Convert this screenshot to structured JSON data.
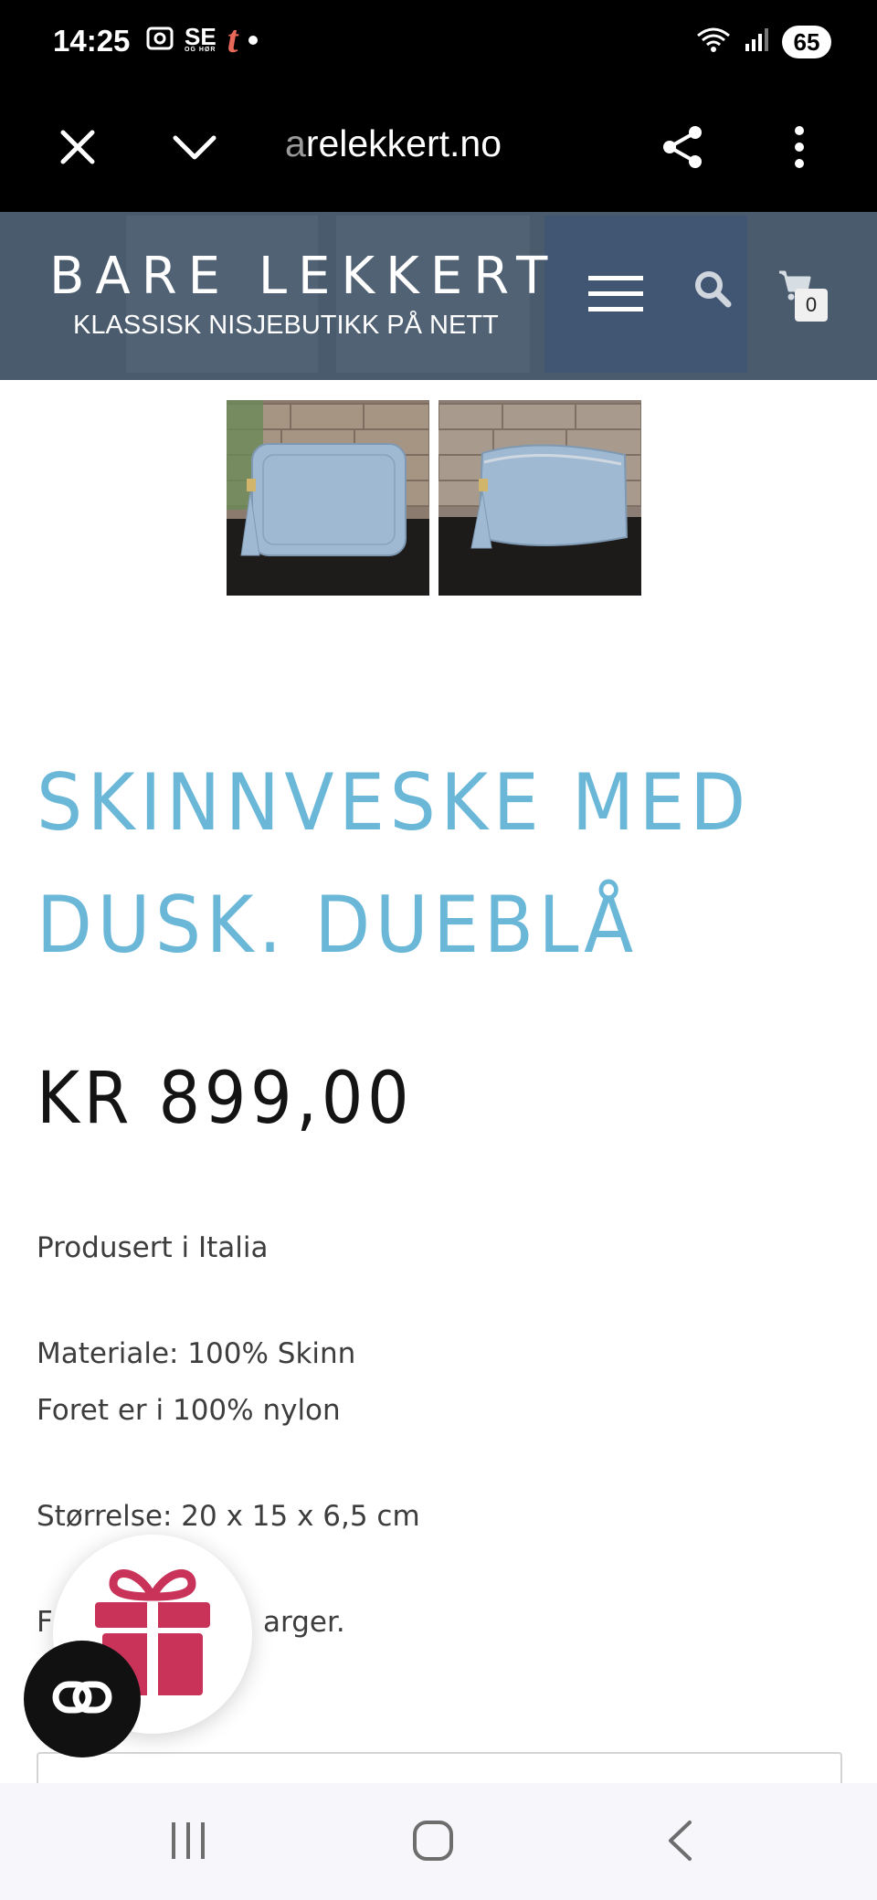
{
  "status_bar": {
    "time": "14:25",
    "app_icons": [
      "screenshot-icon",
      "se-og-hor-icon",
      "tv2-t-icon",
      "notification-dot-icon"
    ],
    "se_label": "SE",
    "se_sub": "OG HØR",
    "t_label": "t",
    "battery": "65"
  },
  "browser": {
    "url_faded": "a",
    "url": "relekkert.no"
  },
  "site": {
    "title": "BARE LEKKERT",
    "tagline": "KLASSISK NISJEBUTIKK PÅ NETT",
    "cart_count": "0"
  },
  "product": {
    "title_line1": "SKINNVESKE MED",
    "title_line2": "DUSK. DUEBLÅ",
    "price": "KR 899,00",
    "description": [
      "Produsert i Italia",
      "Materiale: 100% Skinn",
      "Foret er i 100% nylon",
      "Størrelse: 20 x 15 x 6,5 cm",
      "F",
      "arger."
    ]
  },
  "colors": {
    "header_bg": "#4a5b6d",
    "title_accent": "#6bb7d8",
    "gift_red": "#c9335a",
    "bag_blue": "#9fb9d2"
  }
}
